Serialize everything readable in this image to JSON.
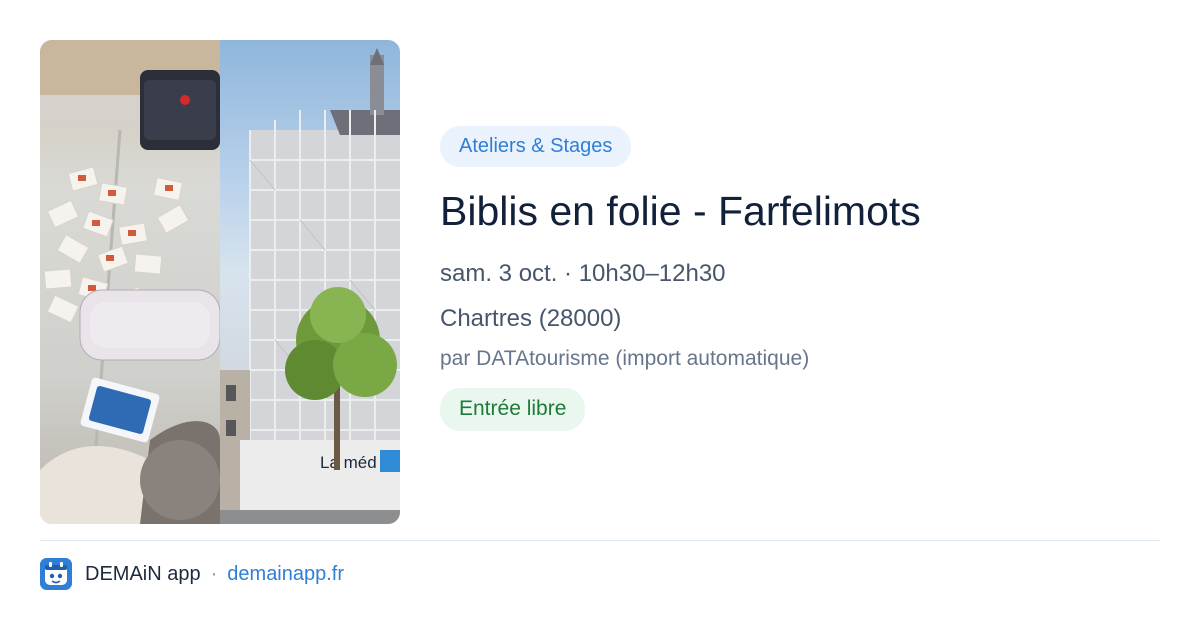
{
  "event": {
    "category": "Ateliers & Stages",
    "title": "Biblis en folie - Farfelimots",
    "datetime": "sam. 3 oct. · 10h30–12h30",
    "location": "Chartres (28000)",
    "source": "par DATAtourisme (import automatique)",
    "price": "Entrée libre"
  },
  "image": {
    "left_photo": "children-playing-card-game-photo",
    "right_photo": "mediatheque-building-scaffolding-photo",
    "building_sign": "La méd"
  },
  "footer": {
    "app_name": "DEMAiN app",
    "separator": "·",
    "domain": "demainapp.fr",
    "icon": "demain-app-icon"
  },
  "colors": {
    "accent": "#2f7fd6",
    "category_bg": "#eaf2fd",
    "price_text": "#1f7a3a",
    "price_bg": "#e9f7ee",
    "title": "#12213a",
    "meta": "#47566b"
  }
}
